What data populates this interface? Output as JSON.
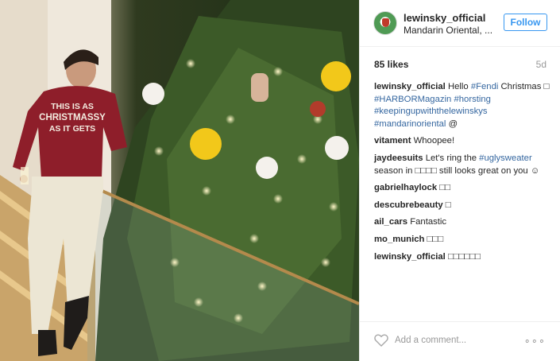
{
  "post": {
    "username": "lewinsky_official",
    "location": "Mandarin Oriental, ...",
    "follow_label": "Follow",
    "likes": "85 likes",
    "age": "5d",
    "sweater_text": [
      "THIS IS AS",
      "CHRISTMASSY",
      "AS IT GETS"
    ]
  },
  "comments": [
    {
      "user": "lewinsky_official",
      "parts": [
        {
          "t": "Hello "
        },
        {
          "t": "#Fendi",
          "tag": true
        },
        {
          "t": " Christmas □ "
        },
        {
          "t": "#HARBORMagazin",
          "tag": true
        },
        {
          "t": " "
        },
        {
          "t": "#horsting",
          "tag": true
        },
        {
          "t": " "
        },
        {
          "t": "#keepingupwiththelewinskys",
          "tag": true
        },
        {
          "t": " "
        },
        {
          "t": "#mandarinoriental",
          "tag": true
        },
        {
          "t": " @"
        }
      ]
    },
    {
      "user": "vitament",
      "parts": [
        {
          "t": "Whoopee!"
        }
      ]
    },
    {
      "user": "jaydeesuits",
      "parts": [
        {
          "t": "Let's ring the "
        },
        {
          "t": "#uglysweater",
          "tag": true
        },
        {
          "t": " season in □□□□ still looks great on you ☺"
        }
      ]
    },
    {
      "user": "gabrielhaylock",
      "parts": [
        {
          "t": "□□"
        }
      ]
    },
    {
      "user": "descubrebeauty",
      "parts": [
        {
          "t": "□"
        }
      ]
    },
    {
      "user": "ail_cars",
      "parts": [
        {
          "t": "Fantastic"
        }
      ]
    },
    {
      "user": "mo_munich",
      "parts": [
        {
          "t": "□□□"
        }
      ]
    },
    {
      "user": "lewinsky_official",
      "parts": [
        {
          "t": "□□□□□□"
        }
      ]
    }
  ],
  "footer": {
    "add_comment_placeholder": "Add a comment...",
    "more_options": "∘∘∘"
  },
  "colors": {
    "tag": "#3567a0",
    "follow": "#3897f0"
  },
  "icons": {
    "heart": "heart-icon",
    "more": "more-options-icon"
  }
}
